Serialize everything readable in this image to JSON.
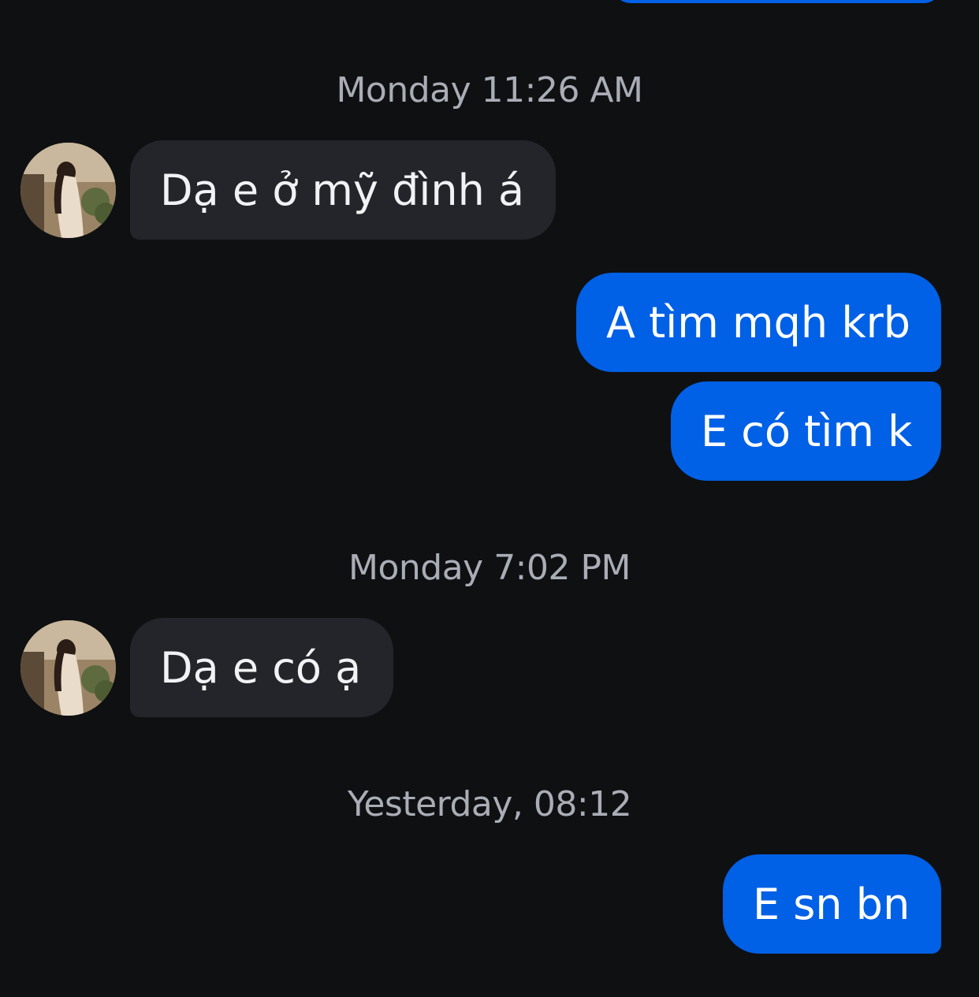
{
  "messages": [
    {
      "type": "timestamp",
      "text": "Monday 11:26 AM"
    },
    {
      "type": "incoming",
      "text": "Dạ e ở mỹ đình á",
      "avatar": "contact-avatar"
    },
    {
      "type": "outgoing",
      "text": "A tìm mqh krb"
    },
    {
      "type": "outgoing",
      "text": "E có tìm k"
    },
    {
      "type": "timestamp",
      "text": "Monday 7:02 PM"
    },
    {
      "type": "incoming",
      "text": "Dạ e có ạ",
      "avatar": "contact-avatar"
    },
    {
      "type": "timestamp",
      "text": "Yesterday, 08:12"
    },
    {
      "type": "outgoing",
      "text": "E sn bn"
    }
  ],
  "colors": {
    "background": "#0f1012",
    "incoming_bubble": "#23252a",
    "outgoing_bubble": "#0060e6",
    "timestamp_text": "#a9adb6"
  }
}
